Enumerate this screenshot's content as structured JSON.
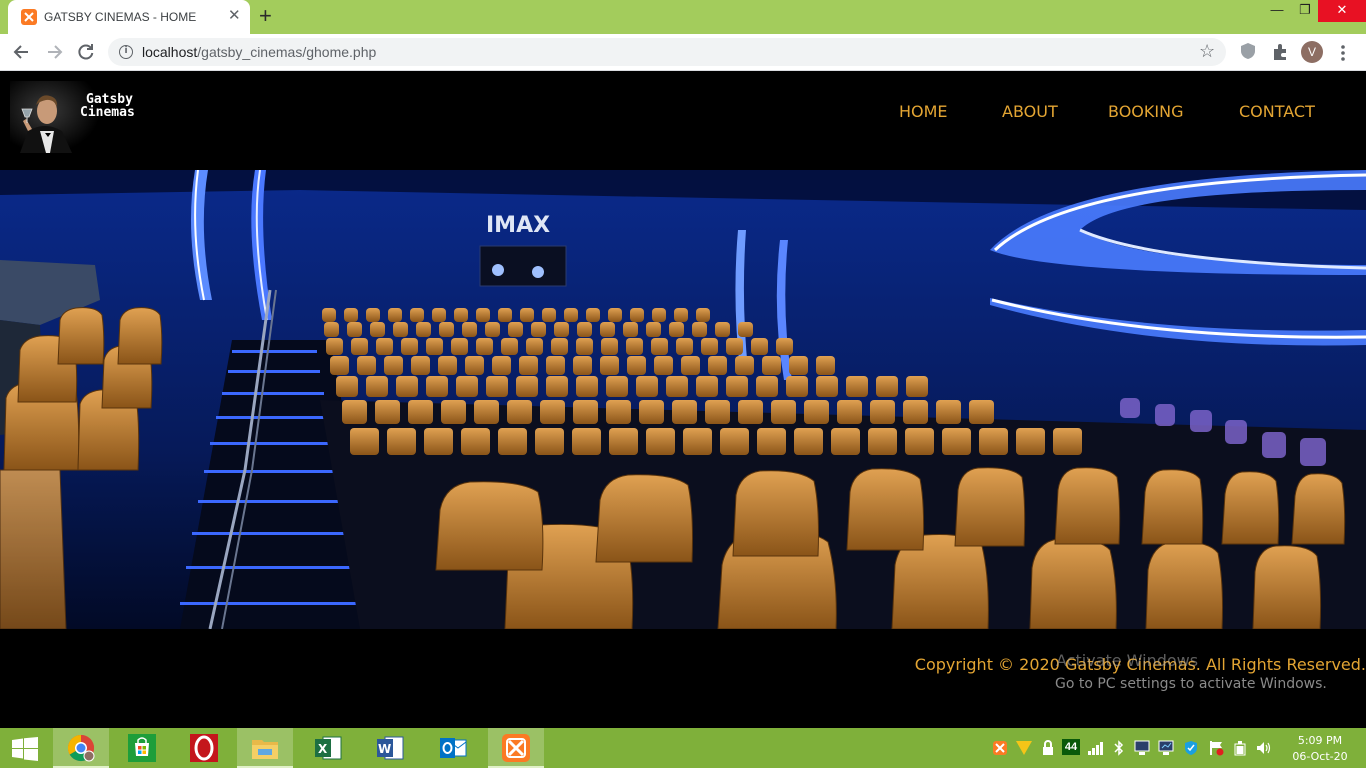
{
  "browser": {
    "tab_title": "GATSBY CINEMAS - HOME",
    "tab_close": "✕",
    "new_tab": "+",
    "window_min": "—",
    "window_max": "❐",
    "window_close": "✕",
    "url_host": "localhost",
    "url_path": "/gatsby_cinemas/ghome.php",
    "profile_initial": "V"
  },
  "site": {
    "logo_line1": "Gatsby",
    "logo_line2": "Cinemas",
    "nav": [
      {
        "label": "HOME"
      },
      {
        "label": "ABOUT"
      },
      {
        "label": "BOOKING"
      },
      {
        "label": "CONTACT"
      }
    ],
    "hero_caption": "IMAX",
    "footer": "Copyright © 2020 Gatsby Cinemas. All Rights Reserved."
  },
  "watermark": {
    "title": "Activate Windows",
    "subtitle": "Go to PC settings to activate Windows."
  },
  "taskbar": {
    "apps": [
      {
        "name": "chrome",
        "active": true
      },
      {
        "name": "store",
        "active": false
      },
      {
        "name": "opera",
        "active": false
      },
      {
        "name": "file-explorer",
        "active": false
      },
      {
        "name": "excel",
        "active": false
      },
      {
        "name": "word",
        "active": false
      },
      {
        "name": "outlook",
        "active": false
      },
      {
        "name": "xampp",
        "active": true
      }
    ],
    "battery_badge": "44",
    "time": "5:09 PM",
    "date": "06-Oct-20"
  },
  "colors": {
    "accent": "#e3a533",
    "chrome_frame": "#a3cc5c",
    "taskbar": "#7fb03a"
  }
}
